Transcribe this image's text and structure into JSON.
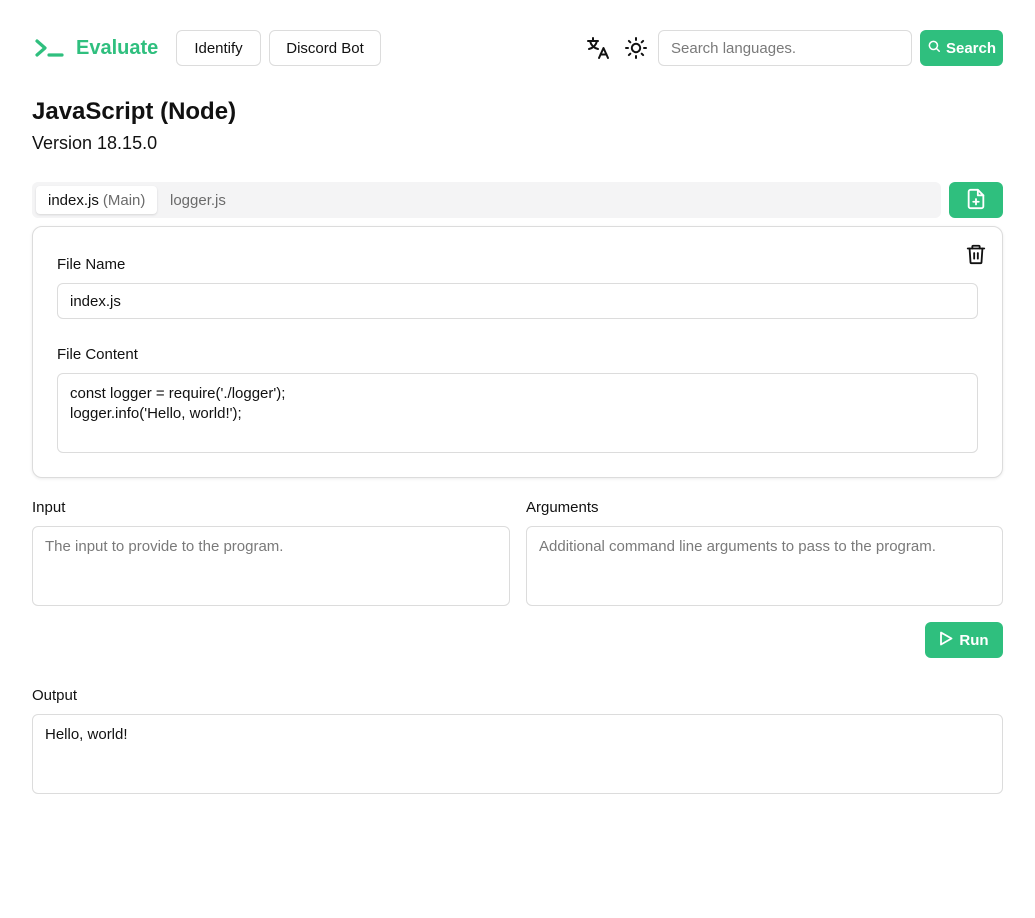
{
  "header": {
    "logo_text": "Evaluate",
    "nav": {
      "identify": "Identify",
      "discord_bot": "Discord Bot"
    },
    "search": {
      "placeholder": "Search languages.",
      "button": "Search"
    }
  },
  "page": {
    "title": "JavaScript (Node)",
    "version": "Version 18.15.0"
  },
  "tabs": [
    {
      "name": "index.js",
      "tag": "(Main)",
      "active": true
    },
    {
      "name": "logger.js",
      "active": false
    }
  ],
  "file": {
    "name_label": "File Name",
    "name_value": "index.js",
    "content_label": "File Content",
    "content_lines": [
      "const logger = require('./logger');",
      "logger.info('Hello, world!');"
    ]
  },
  "input": {
    "label": "Input",
    "placeholder": "The input to provide to the program."
  },
  "arguments": {
    "label": "Arguments",
    "placeholder": "Additional command line arguments to pass to the program."
  },
  "run": {
    "label": "Run"
  },
  "output": {
    "label": "Output",
    "value": "Hello, world!"
  },
  "colors": {
    "accent": "#2fbf7e",
    "border": "#dcdcdc",
    "tabbar_bg": "#f4f4f5"
  },
  "icons": {
    "logo": "terminal-prompt-icon",
    "translate": "translate-icon",
    "theme": "sun-icon",
    "search": "search-icon",
    "add_file": "file-plus-icon",
    "delete": "trash-icon",
    "run": "play-icon"
  }
}
